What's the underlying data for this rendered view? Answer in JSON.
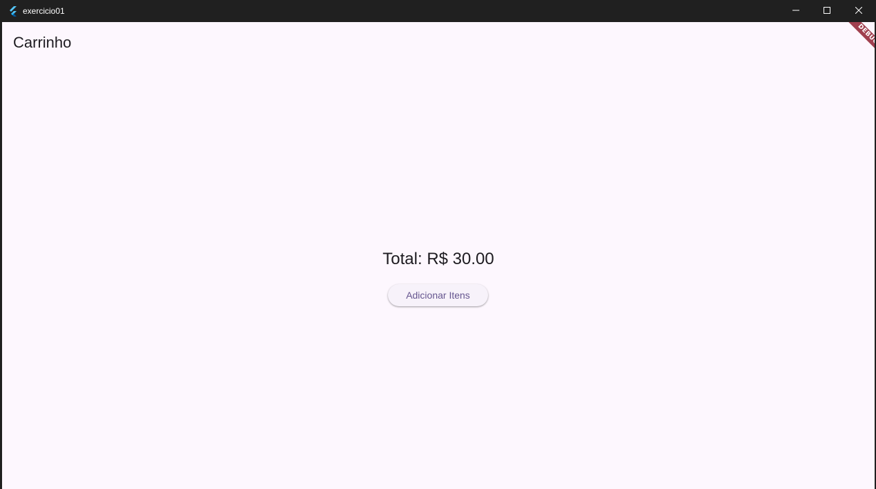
{
  "window": {
    "title": "exercicio01",
    "app_icon": "flutter-logo-icon",
    "controls": {
      "minimize_icon": "minimize-icon",
      "maximize_icon": "maximize-icon",
      "close_icon": "close-icon"
    }
  },
  "appbar": {
    "title": "Carrinho"
  },
  "main": {
    "total_text": "Total: R$ 30.00",
    "add_button_label": "Adicionar Itens"
  },
  "debug_banner": {
    "label": "DEBUG"
  },
  "colors": {
    "titlebar_bg": "#202020",
    "content_bg": "#fdf7fe",
    "text": "#1d1b20",
    "button_bg": "#f7f2fa",
    "button_text": "#65558f",
    "debug_banner": "#a0404f"
  }
}
